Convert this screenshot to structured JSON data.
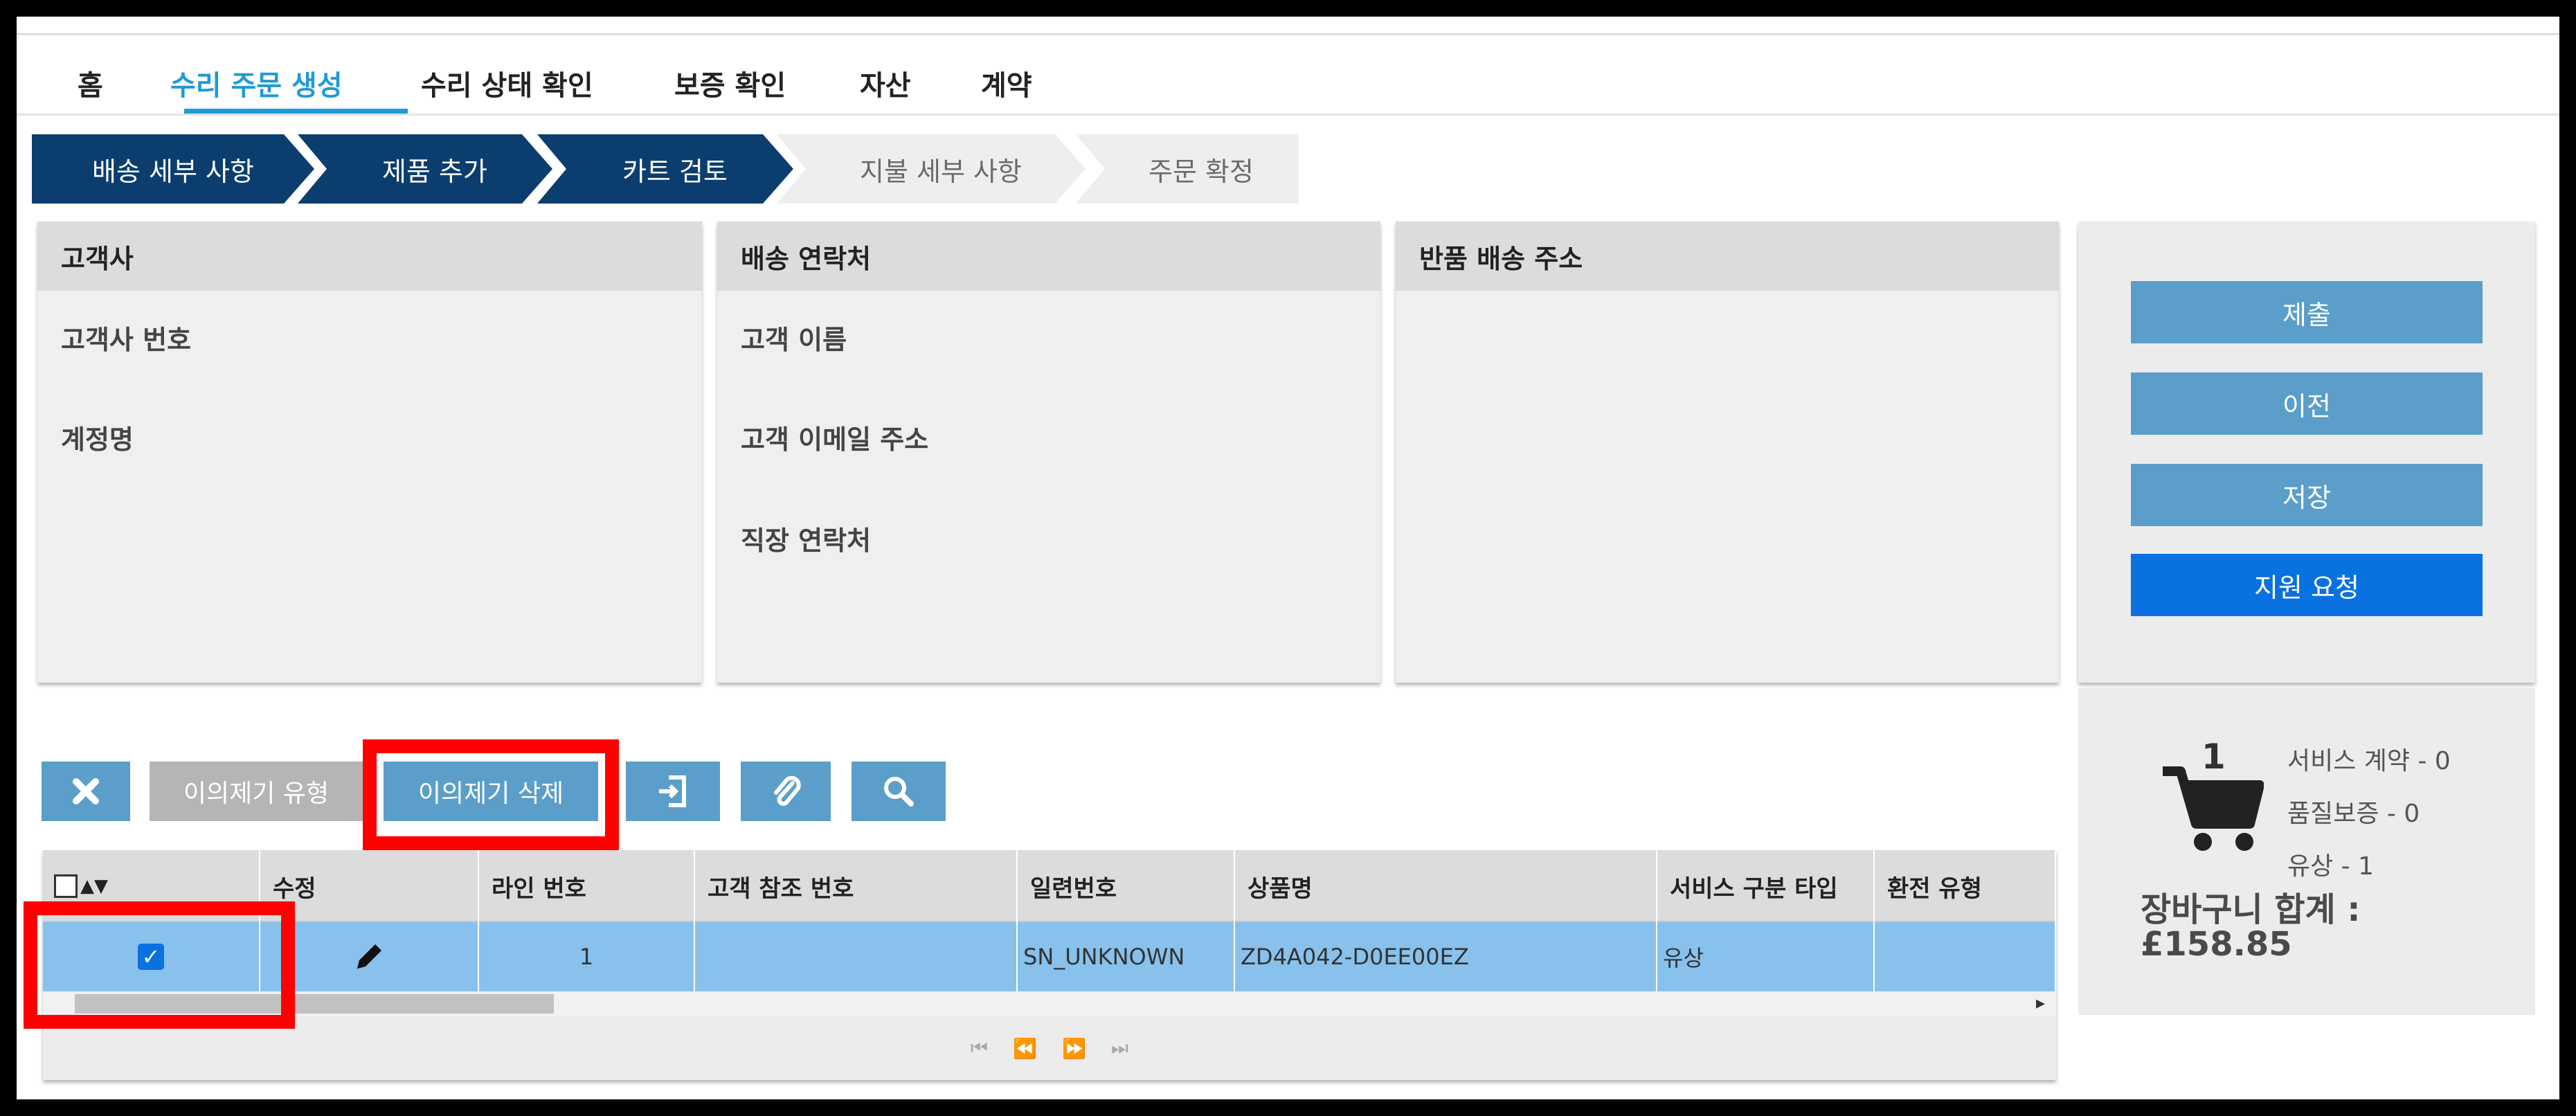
{
  "nav": {
    "items": [
      "홈",
      "수리 주문 생성",
      "수리 상태 확인",
      "보증 확인",
      "자산",
      "계약"
    ],
    "active": "수리 주문 생성"
  },
  "steps": [
    "배송 세부 사항",
    "제품 추가",
    "카트 검토",
    "지불 세부 사항",
    "주문 확정"
  ],
  "panels": {
    "customer": {
      "title": "고객사",
      "fields": [
        "고객사 번호",
        "계정명"
      ]
    },
    "contact": {
      "title": "배송 연락처",
      "fields": [
        "고객 이름",
        "고객 이메일 주소",
        "직장 연락처"
      ]
    },
    "return_address": {
      "title": "반품 배송 주소"
    }
  },
  "actions": {
    "submit": "제출",
    "previous": "이전",
    "save": "저장",
    "request_support": "지원 요청"
  },
  "cart": {
    "count": "1",
    "service_contract": "서비스 계약 - 0",
    "warranty": "품질보증 - 0",
    "paid": "유상 - 1",
    "total_label": "장바구니 합계 :",
    "total_value": "£158.85"
  },
  "toolbar": {
    "issue_type": "이의제기 유형",
    "delete_issue": "이의제기 삭제",
    "icons": [
      "close-icon",
      "login-icon",
      "paperclip-icon",
      "search-icon"
    ]
  },
  "grid": {
    "columns": [
      "수정",
      "라인 번호",
      "고객 참조 번호",
      "일련번호",
      "상품명",
      "서비스 구분 타입",
      "환전 유형"
    ],
    "rows": [
      {
        "selected": true,
        "line": "1",
        "customer_ref": "",
        "serial": "SN_UNKNOWN",
        "product": "ZD4A042-D0EE00EZ",
        "service_type": "유상",
        "exchange_type": ""
      }
    ]
  },
  "colors": {
    "accent": "#1f9ad6",
    "step_done": "#0b3e6f",
    "button": "#5b9ec9",
    "primary": "#0a71e0",
    "selected_row": "#87c1ec",
    "highlight": "#ff0000"
  }
}
